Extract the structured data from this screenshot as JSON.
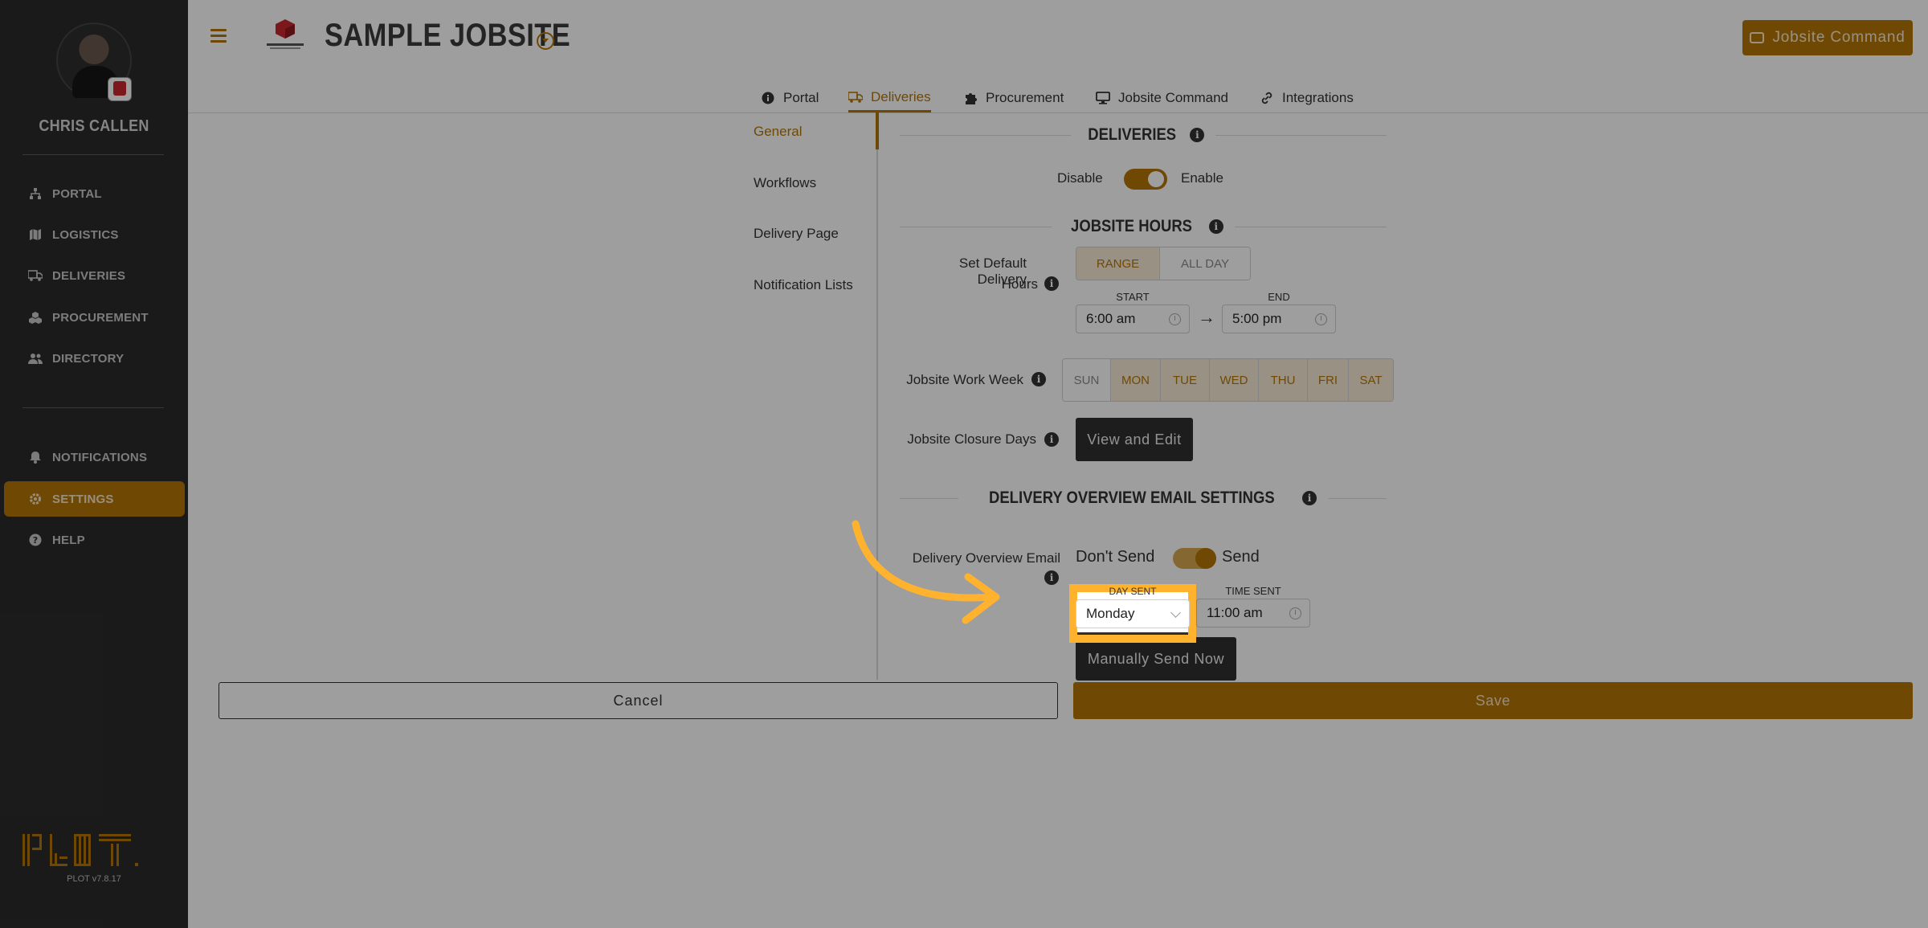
{
  "sidebar": {
    "user_name": "CHRIS CALLEN",
    "items_top": [
      {
        "label": "PORTAL",
        "icon": "sitemap-icon"
      },
      {
        "label": "LOGISTICS",
        "icon": "map-icon"
      },
      {
        "label": "DELIVERIES",
        "icon": "truck-icon"
      },
      {
        "label": "PROCUREMENT",
        "icon": "cubes-icon"
      },
      {
        "label": "DIRECTORY",
        "icon": "users-icon"
      }
    ],
    "items_bottom": [
      {
        "label": "NOTIFICATIONS",
        "icon": "bell-icon"
      },
      {
        "label": "SETTINGS",
        "icon": "gear-icon",
        "active": true
      },
      {
        "label": "HELP",
        "icon": "question-icon"
      }
    ],
    "version": "PLOT v7.8.17"
  },
  "header": {
    "project_title": "SAMPLE JOBSITE",
    "jobsite_command_label": "Jobsite Command"
  },
  "tabs": [
    {
      "label": "Portal",
      "icon": "info-circle-icon"
    },
    {
      "label": "Deliveries",
      "icon": "truck-icon",
      "active": true
    },
    {
      "label": "Procurement",
      "icon": "puzzle-icon"
    },
    {
      "label": "Jobsite Command",
      "icon": "monitor-icon"
    },
    {
      "label": "Integrations",
      "icon": "link-icon"
    }
  ],
  "subnav": [
    "General",
    "Workflows",
    "Delivery Page",
    "Notification Lists"
  ],
  "deliveries": {
    "section_title": "DELIVERIES",
    "disable_label": "Disable",
    "enable_label": "Enable"
  },
  "jobsite_hours": {
    "section_title": "JOBSITE HOURS",
    "default_hours_label_1": "Set Default Delivery",
    "default_hours_label_2": "Hours",
    "range_label": "RANGE",
    "all_day_label": "ALL DAY",
    "start_label": "START",
    "end_label": "END",
    "start_value": "6:00 am",
    "end_value": "5:00 pm",
    "work_week_label": "Jobsite Work Week",
    "days": [
      "SUN",
      "MON",
      "TUE",
      "WED",
      "THU",
      "FRI",
      "SAT"
    ],
    "closure_label": "Jobsite Closure Days",
    "view_edit_label": "View and Edit"
  },
  "email_settings": {
    "section_title": "DELIVERY OVERVIEW EMAIL SETTINGS",
    "email_label": "Delivery Overview Email",
    "dont_send_label": "Don't Send",
    "send_label": "Send",
    "day_sent_label": "DAY SENT",
    "day_sent_value": "Monday",
    "time_sent_label": "TIME SENT",
    "time_sent_value": "11:00 am",
    "manual_send_label": "Manually Send Now"
  },
  "actions": {
    "cancel_label": "Cancel",
    "save_label": "Save"
  },
  "colors": {
    "accent": "#b37608",
    "highlight": "#ffb22e",
    "sidebar_bg": "#2b2b2b"
  }
}
